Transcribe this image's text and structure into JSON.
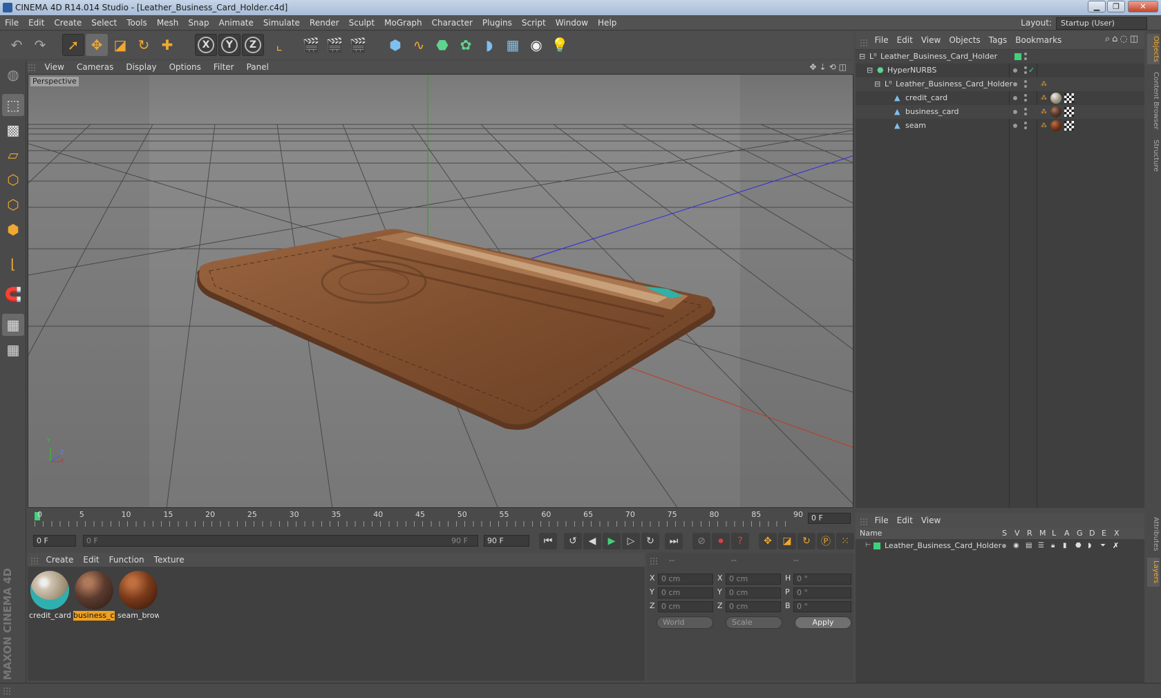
{
  "window": {
    "title": "CINEMA 4D R14.014 Studio - [Leather_Business_Card_Holder.c4d]",
    "controls": [
      "▁",
      "❐",
      "✕"
    ]
  },
  "menubar": {
    "items": [
      "File",
      "Edit",
      "Create",
      "Select",
      "Tools",
      "Mesh",
      "Snap",
      "Animate",
      "Simulate",
      "Render",
      "Sculpt",
      "MoGraph",
      "Character",
      "Plugins",
      "Script",
      "Window",
      "Help"
    ],
    "layout_label": "Layout:",
    "layout_value": "Startup (User)"
  },
  "toolbar": {
    "axis_x": "X",
    "axis_y": "Y",
    "axis_z": "Z"
  },
  "viewport": {
    "menu": [
      "View",
      "Cameras",
      "Display",
      "Options",
      "Filter",
      "Panel"
    ],
    "camera_label": "Perspective",
    "axis_labels": {
      "y": "Y",
      "z": "Z",
      "x": "X"
    }
  },
  "timeline": {
    "ticks": [
      "0",
      "5",
      "10",
      "15",
      "20",
      "25",
      "30",
      "35",
      "40",
      "45",
      "50",
      "55",
      "60",
      "65",
      "70",
      "75",
      "80",
      "85",
      "90"
    ],
    "current_frame": "0 F",
    "start_frame": "0 F",
    "range_start": "0 F",
    "range_end": "90 F",
    "end_frame": "90 F"
  },
  "materials": {
    "menu": [
      "Create",
      "Edit",
      "Function",
      "Texture"
    ],
    "items": [
      {
        "name": "credit_card",
        "active": false
      },
      {
        "name": "business_c",
        "active": true
      },
      {
        "name": "seam_brow",
        "active": false
      }
    ]
  },
  "coordinates": {
    "headers": [
      "--",
      "--",
      "--"
    ],
    "rows": [
      {
        "a1": "X",
        "v1": "0 cm",
        "a2": "X",
        "v2": "0 cm",
        "a3": "H",
        "v3": "0 °"
      },
      {
        "a1": "Y",
        "v1": "0 cm",
        "a2": "Y",
        "v2": "0 cm",
        "a3": "P",
        "v3": "0 °"
      },
      {
        "a1": "Z",
        "v1": "0 cm",
        "a2": "Z",
        "v2": "0 cm",
        "a3": "B",
        "v3": "0 °"
      }
    ],
    "world": "World",
    "scale": "Scale",
    "apply": "Apply"
  },
  "objects": {
    "menu": [
      "File",
      "Edit",
      "View",
      "Objects",
      "Tags",
      "Bookmarks"
    ],
    "tree": [
      {
        "name": "Leather_Business_Card_Holder",
        "indent": 0,
        "type": "null"
      },
      {
        "name": "HyperNURBS",
        "indent": 1,
        "type": "nurbs"
      },
      {
        "name": "Leather_Business_Card_Holder",
        "indent": 2,
        "type": "null"
      },
      {
        "name": "credit_card",
        "indent": 3,
        "type": "poly"
      },
      {
        "name": "business_card",
        "indent": 3,
        "type": "poly"
      },
      {
        "name": "seam",
        "indent": 3,
        "type": "poly"
      }
    ]
  },
  "sidetabs": [
    "Objects",
    "Content Browser",
    "Structure",
    "Attributes",
    "Layers"
  ],
  "layers": {
    "menu": [
      "File",
      "Edit",
      "View"
    ],
    "columns": [
      "Name",
      "S",
      "V",
      "R",
      "M",
      "L",
      "A",
      "G",
      "D",
      "E",
      "X"
    ],
    "rows": [
      {
        "name": "Leather_Business_Card_Holder"
      }
    ]
  },
  "branding": "MAXON CINEMA 4D",
  "colors": {
    "accent": "#f0a830",
    "leather": "#8b5a35",
    "layer_green": "#3fd27a"
  }
}
